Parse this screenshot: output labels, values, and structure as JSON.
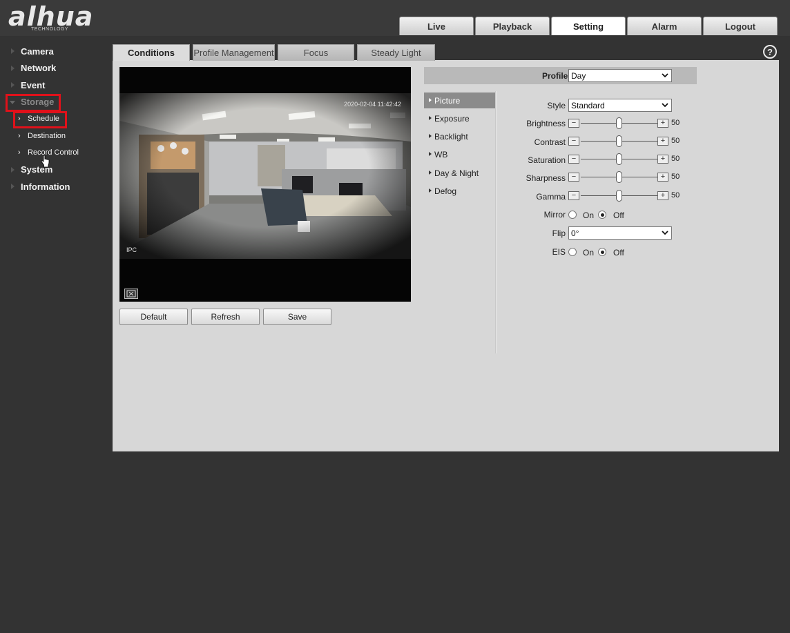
{
  "brand": {
    "logo": "alhua",
    "sub": "TECHNOLOGY"
  },
  "top_nav": [
    {
      "label": "Live",
      "active": false
    },
    {
      "label": "Playback",
      "active": false
    },
    {
      "label": "Setting",
      "active": true
    },
    {
      "label": "Alarm",
      "active": false
    },
    {
      "label": "Logout",
      "active": false
    }
  ],
  "sidebar": {
    "items": [
      {
        "label": "Camera"
      },
      {
        "label": "Network"
      },
      {
        "label": "Event"
      },
      {
        "label": "Storage"
      },
      {
        "label": "System"
      },
      {
        "label": "Information"
      }
    ],
    "storage_sub": [
      {
        "label": "Schedule"
      },
      {
        "label": "Destination"
      },
      {
        "label": "Record Control"
      }
    ]
  },
  "sub_tabs": [
    {
      "label": "Conditions",
      "active": true
    },
    {
      "label": "Profile Management",
      "active": false
    },
    {
      "label": "Focus",
      "active": false
    },
    {
      "label": "Steady Light",
      "active": false
    }
  ],
  "help": "?",
  "video": {
    "timestamp": "2020-02-04 11:42:42",
    "channel": "IPC"
  },
  "buttons": {
    "default": "Default",
    "refresh": "Refresh",
    "save": "Save"
  },
  "profile": {
    "label": "Profile",
    "value": "Day"
  },
  "menu": [
    {
      "label": "Picture",
      "active": true
    },
    {
      "label": "Exposure",
      "active": false
    },
    {
      "label": "Backlight",
      "active": false
    },
    {
      "label": "WB",
      "active": false
    },
    {
      "label": "Day & Night",
      "active": false
    },
    {
      "label": "Defog",
      "active": false
    }
  ],
  "picture": {
    "style_label": "Style",
    "style_value": "Standard",
    "sliders": [
      {
        "label": "Brightness",
        "value": "50"
      },
      {
        "label": "Contrast",
        "value": "50"
      },
      {
        "label": "Saturation",
        "value": "50"
      },
      {
        "label": "Sharpness",
        "value": "50"
      },
      {
        "label": "Gamma",
        "value": "50"
      }
    ],
    "mirror": {
      "label": "Mirror",
      "on": "On",
      "off": "Off",
      "selected": "Off"
    },
    "flip": {
      "label": "Flip",
      "value": "0°"
    },
    "eis": {
      "label": "EIS",
      "on": "On",
      "off": "Off",
      "selected": "Off"
    }
  },
  "colors": {
    "highlight": "#e0111a",
    "panel": "#d7d7d7",
    "background": "#333333"
  }
}
